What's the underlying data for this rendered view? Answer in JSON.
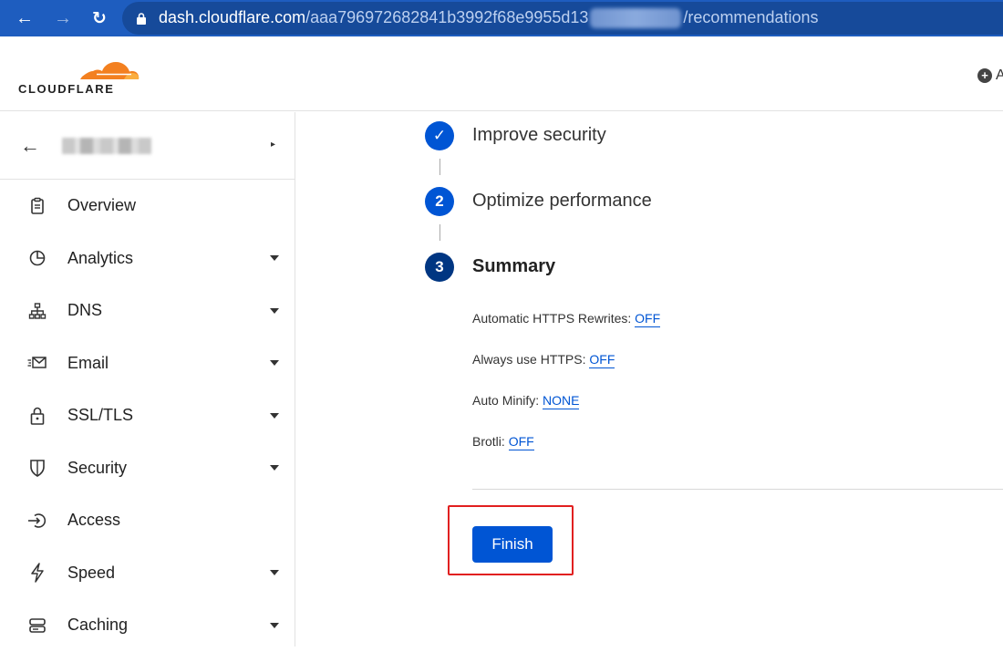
{
  "browser": {
    "nav": {
      "back": "←",
      "forward": "→",
      "reload": "↻"
    },
    "url_host": "dash.cloudflare.com",
    "url_path_start": "/aaa796972682841b3992f68e9955d13",
    "url_path_end": "/recommendations"
  },
  "header": {
    "logo_text": "CLOUDFLARE",
    "add_icon": "+",
    "add_label_partial": "A"
  },
  "sidebar": {
    "zone_back_icon": "←",
    "zone_arrow": "▸",
    "items": [
      {
        "label": "Overview",
        "icon": "clipboard-icon",
        "caret": false
      },
      {
        "label": "Analytics",
        "icon": "pie-chart-icon",
        "caret": true
      },
      {
        "label": "DNS",
        "icon": "network-icon",
        "caret": true
      },
      {
        "label": "Email",
        "icon": "envelope-icon",
        "caret": true
      },
      {
        "label": "SSL/TLS",
        "icon": "lock-icon",
        "caret": true
      },
      {
        "label": "Security",
        "icon": "shield-icon",
        "caret": true
      },
      {
        "label": "Access",
        "icon": "access-icon",
        "caret": false
      },
      {
        "label": "Speed",
        "icon": "lightning-icon",
        "caret": true
      },
      {
        "label": "Caching",
        "icon": "storage-icon",
        "caret": true
      }
    ]
  },
  "steps": [
    {
      "label": "Improve security",
      "state": "done",
      "marker": "✓"
    },
    {
      "label": "Optimize performance",
      "state": "active",
      "marker": "2"
    },
    {
      "label": "Summary",
      "state": "current",
      "marker": "3"
    }
  ],
  "summary": [
    {
      "label": "Automatic HTTPS Rewrites: ",
      "value": "OFF"
    },
    {
      "label": "Always use HTTPS: ",
      "value": "OFF"
    },
    {
      "label": "Auto Minify: ",
      "value": "NONE"
    },
    {
      "label": "Brotli: ",
      "value": "OFF"
    }
  ],
  "finish_label": "Finish",
  "colors": {
    "accent": "#0055d4",
    "browser_bar": "#1e5dbf",
    "highlight": "#e12020",
    "logo_orange": "#f38020"
  }
}
